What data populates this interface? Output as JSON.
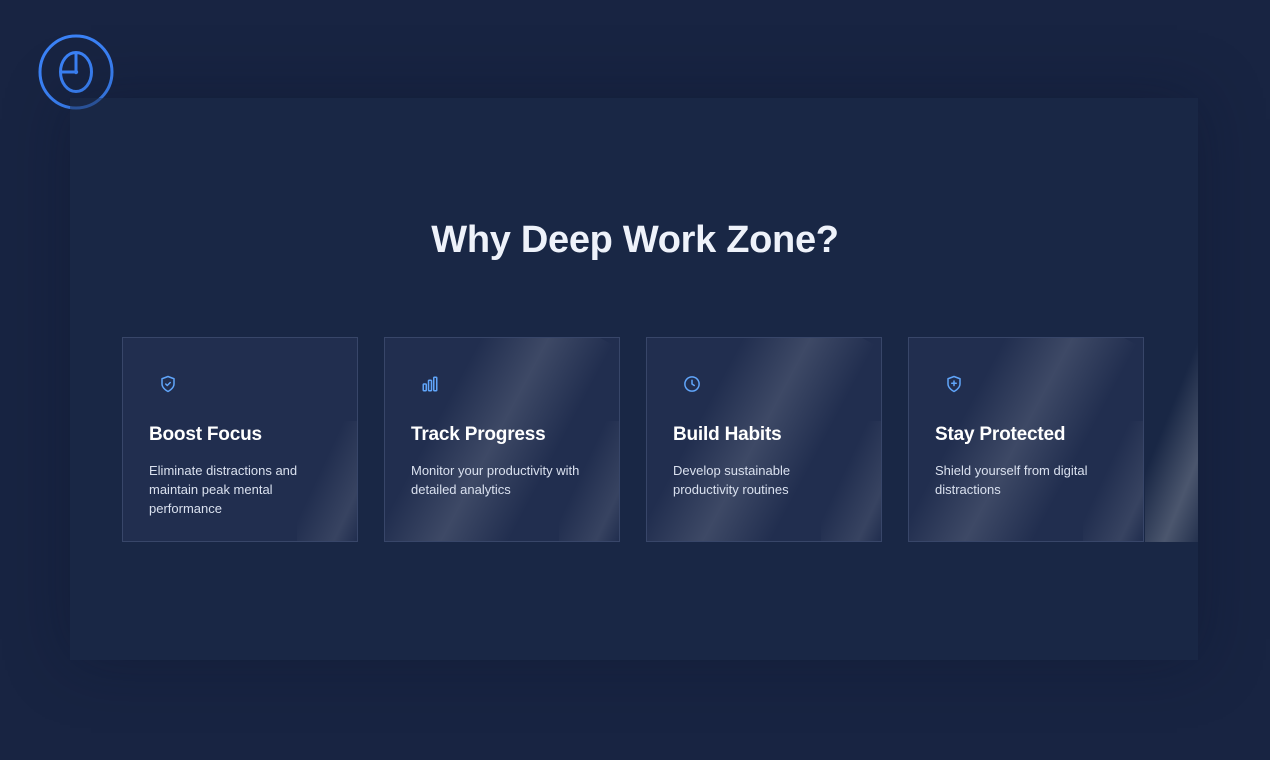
{
  "page": {
    "title": "Why Deep Work Zone?"
  },
  "logo": {
    "icon": "clock-icon",
    "color": "#3b82f6"
  },
  "features": [
    {
      "icon": "shield-check-icon",
      "title": "Boost Focus",
      "description": "Eliminate distractions and maintain peak mental performance"
    },
    {
      "icon": "bar-chart-icon",
      "title": "Track Progress",
      "description": "Monitor your productivity with detailed analytics"
    },
    {
      "icon": "clock-icon",
      "title": "Build Habits",
      "description": "Develop sustainable productivity routines"
    },
    {
      "icon": "shield-plus-icon",
      "title": "Stay Protected",
      "description": "Shield yourself from digital distractions"
    }
  ],
  "colors": {
    "background": "#182442",
    "accent": "#60a5fa",
    "text": "#ffffff",
    "muted_text": "#d9e0ee"
  }
}
